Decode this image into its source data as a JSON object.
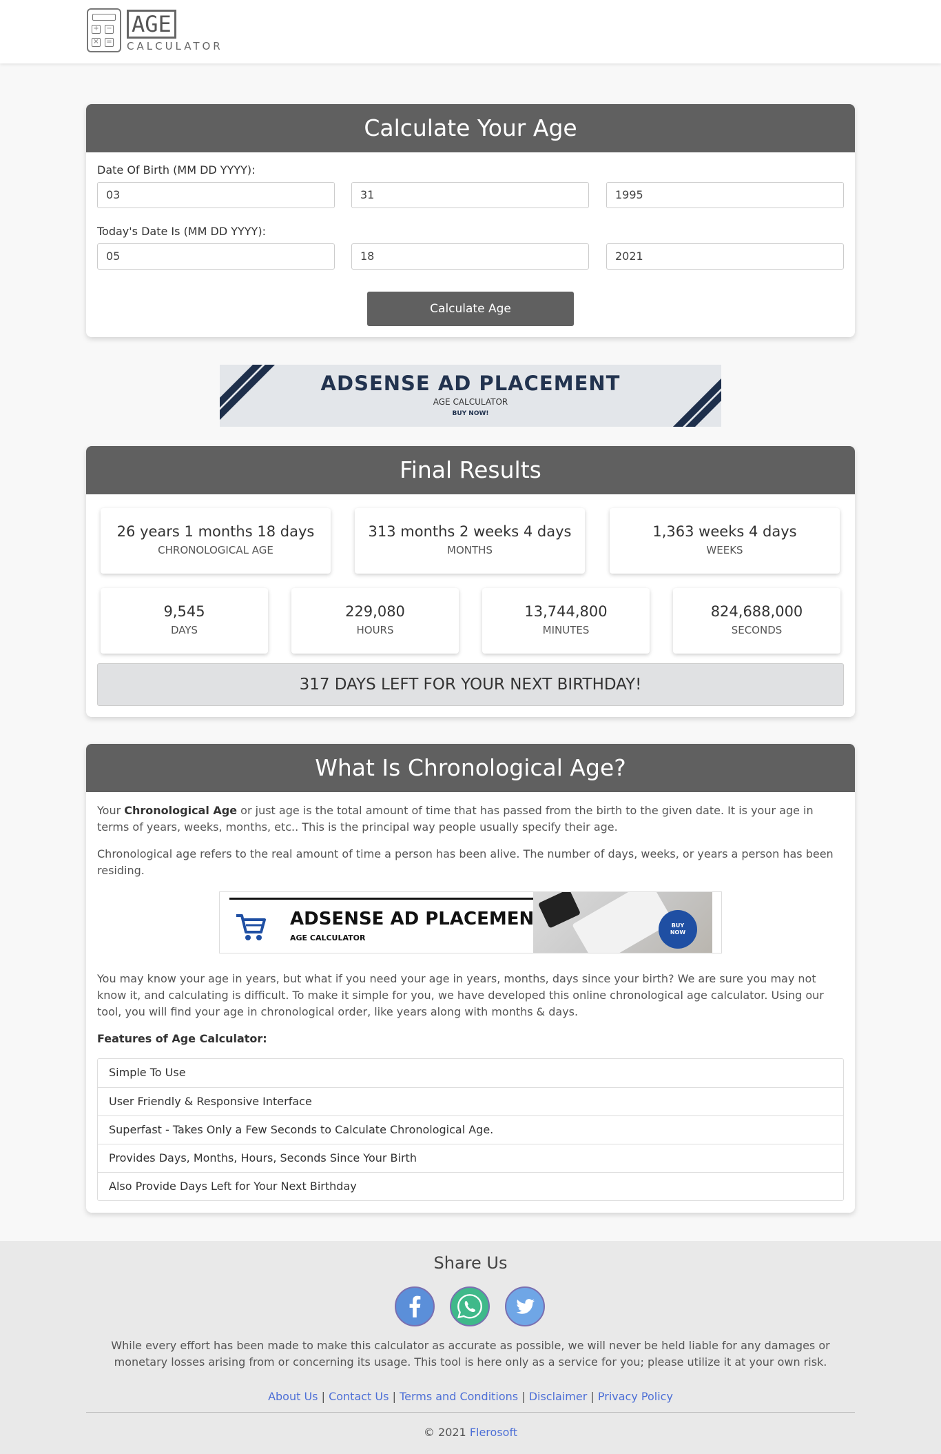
{
  "header": {
    "logo_word": "AGE",
    "logo_sub": "CALCULATOR"
  },
  "calculator": {
    "title": "Calculate Your Age",
    "dob_label": "Date Of Birth (MM DD YYYY):",
    "dob": {
      "month": "03",
      "day": "31",
      "year": "1995"
    },
    "today_label": "Today's Date Is (MM DD YYYY):",
    "today": {
      "month": "05",
      "day": "18",
      "year": "2021"
    },
    "button": "Calculate Age"
  },
  "ad_banner_1": {
    "headline": "ADSENSE AD PLACEMENT",
    "sub": "AGE CALCULATOR",
    "cta": "BUY NOW!"
  },
  "results": {
    "title": "Final Results",
    "top_row": [
      {
        "value": "26 years 1 months 18 days",
        "label": "CHRONOLOGICAL AGE"
      },
      {
        "value": "313 months 2 weeks 4 days",
        "label": "MONTHS"
      },
      {
        "value": "1,363 weeks 4 days",
        "label": "WEEKS"
      }
    ],
    "bottom_row": [
      {
        "value": "9,545",
        "label": "DAYS"
      },
      {
        "value": "229,080",
        "label": "HOURS"
      },
      {
        "value": "13,744,800",
        "label": "MINUTES"
      },
      {
        "value": "824,688,000",
        "label": "SECONDS"
      }
    ],
    "next_birthday": "317 DAYS LEFT FOR YOUR NEXT BIRTHDAY!"
  },
  "article": {
    "title": "What Is Chronological Age?",
    "p1_prefix": "Your ",
    "p1_bold": "Chronological Age",
    "p1_rest": " or just age is the total amount of time that has passed from the birth to the given date. It is your age in terms of years, weeks, months, etc.. This is the principal way people usually specify their age.",
    "p2": "Chronological age refers to the real amount of time a person has been alive. The number of days, weeks, or years a person has been residing.",
    "p3": "You may know your age in years, but what if you need your age in years, months, days since your birth? We are sure you may not know it, and calculating is difficult. To make it simple for you, we have developed this online chronological age calculator. Using our tool, you will find your age in chronological order, like years along with months & days.",
    "features_title": "Features of Age Calculator:",
    "features": [
      "Simple To Use",
      "User Friendly & Responsive Interface",
      "Superfast - Takes Only a Few Seconds to Calculate Chronological Age.",
      "Provides Days, Months, Hours, Seconds Since Your Birth",
      "Also Provide Days Left for Your Next Birthday"
    ]
  },
  "ad_banner_2": {
    "headline": "ADSENSE AD PLACEMENT",
    "sub": "AGE CALCULATOR",
    "cta_line1": "BUY",
    "cta_line2": "NOW"
  },
  "footer": {
    "share_title": "Share Us",
    "social_icons": [
      "facebook-icon",
      "whatsapp-icon",
      "twitter-icon"
    ],
    "disclaimer": "While every effort has been made to make this calculator as accurate as possible, we will never be held liable for any damages or monetary losses arising from or concerning its usage. This tool is here only as a service for you; please utilize it at your own risk.",
    "links": [
      "About Us",
      "Contact Us",
      "Terms and Conditions",
      "Disclaimer",
      "Privacy Policy"
    ],
    "separator": "|",
    "copyright_prefix": "© 2021 ",
    "copyright_brand": "Flerosoft"
  },
  "colors": {
    "card_header": "#606060",
    "link": "#4d6fd6",
    "facebook": "#3b5998",
    "whatsapp": "#25d366",
    "twitter": "#1da1f2"
  }
}
